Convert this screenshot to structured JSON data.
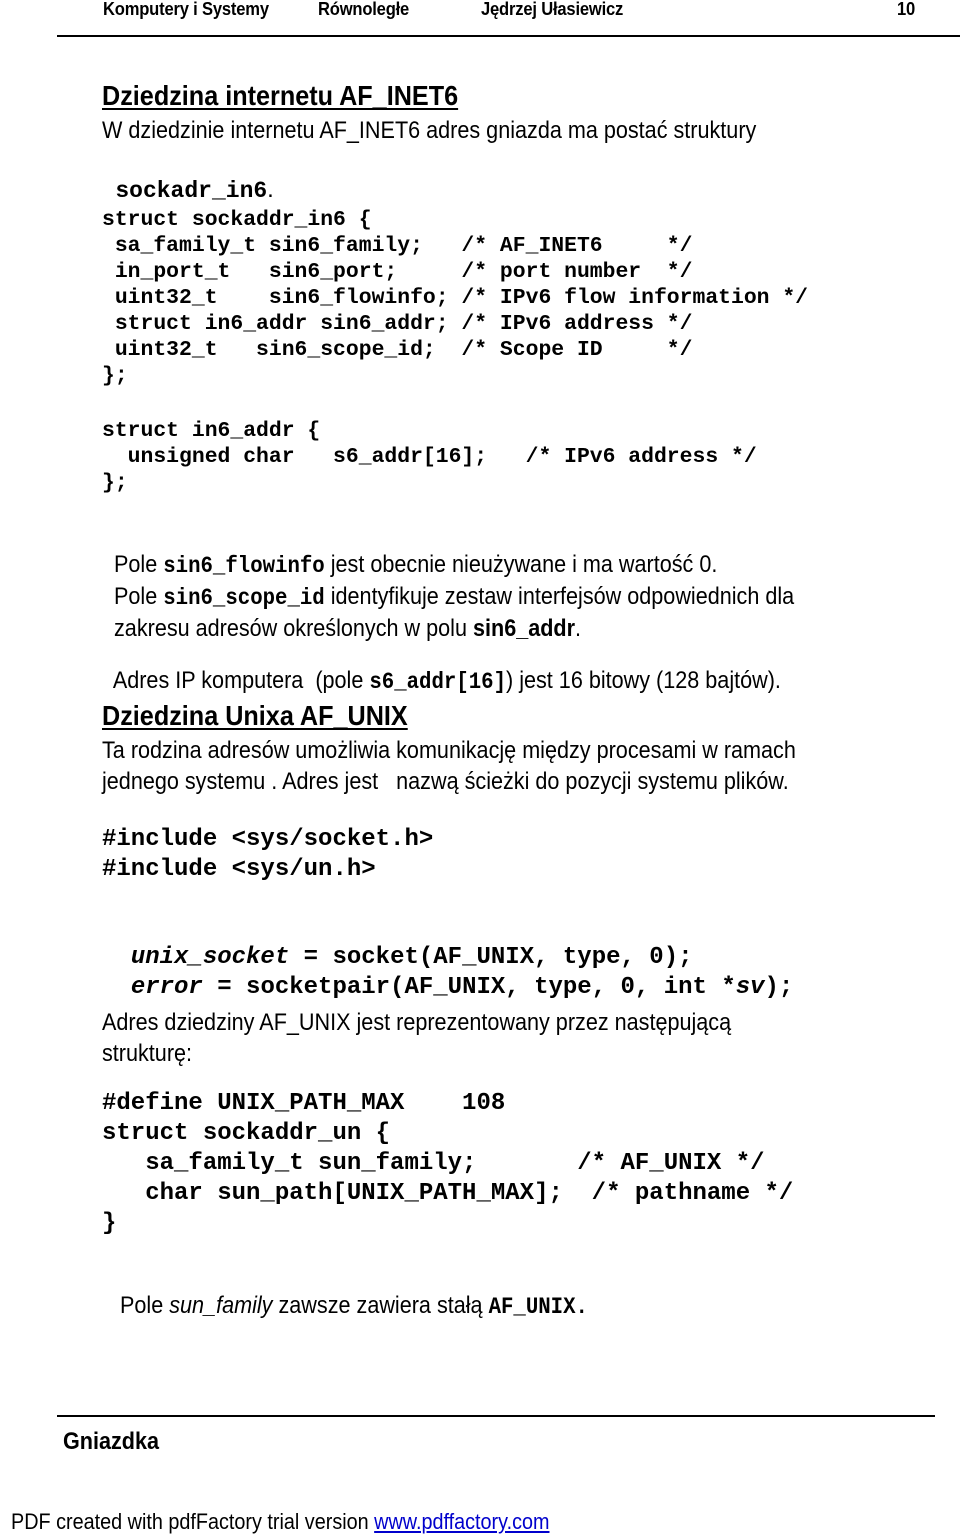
{
  "header": {
    "course": "Komputery i Systemy",
    "course2": "Równoległe",
    "author": "Jędrzej Ułasiewicz",
    "page_number": "10"
  },
  "section1": {
    "title": "Dziedzina internetu AF_INET6",
    "intro_line1": "W dziedzinie internetu AF_INET6 adres gniazda ma postać struktury",
    "intro_code": "sockadr_in6",
    "intro_end": ".",
    "code_sockaddr_in6": [
      "struct sockaddr_in6 {",
      " sa_family_t sin6_family;   /* AF_INET6     */",
      " in_port_t   sin6_port;     /* port number  */",
      " uint32_t    sin6_flowinfo; /* IPv6 flow information */",
      " struct in6_addr sin6_addr; /* IPv6 address */",
      " uint32_t   sin6_scope_id;  /* Scope ID     */",
      "};"
    ],
    "code_in6_addr": [
      "struct in6_addr {",
      "  unsigned char   s6_addr[16];   /* IPv6 address */",
      "};"
    ],
    "para_flowinfo": {
      "pre": "Pole ",
      "code": "sin6_flowinfo",
      "post": " jest obecnie nieużywane i ma wartość 0."
    },
    "para_scope": {
      "pre": "Pole ",
      "code": "sin6_scope_id",
      "post": " identyfikuje zestaw interfejsów odpowiednich dla",
      "line2_pre": "zakresu adresów określonych w polu ",
      "line2_bold": "sin6_addr",
      "line2_post": "."
    },
    "para_addr": {
      "pre": "Adres IP komputera  (pole ",
      "code": "s6_addr[16]",
      "post": ") jest 16 bitowy (128 bajtów)."
    }
  },
  "section2": {
    "title": "Dziedzina Unixa AF_UNIX",
    "intro_line1": "Ta rodzina adresów umożliwia komunikację między procesami w ramach",
    "intro_line2": "jednego systemu . Adres jest   nazwą ścieżki do pozycji systemu plików.",
    "includes": [
      "#include <sys/socket.h>",
      "#include <sys/un.h>"
    ],
    "call1": {
      "var": "unix_socket",
      "rest": " = socket(AF_UNIX, type, 0);"
    },
    "call2": {
      "var": "error",
      "mid": " = socketpair(AF_UNIX, type, 0, int *",
      "arg": "sv",
      "end": ");"
    },
    "struct_intro_line1": "Adres dziedziny AF_UNIX jest reprezentowany przez następującą",
    "struct_intro_line2": "strukturę:",
    "code_sockaddr_un": [
      "#define UNIX_PATH_MAX    108",
      "struct sockaddr_un {",
      "   sa_family_t sun_family;       /* AF_UNIX */",
      "   char sun_path[UNIX_PATH_MAX];  /* pathname */",
      "}"
    ],
    "final_note": {
      "pre": "Pole ",
      "italic": "sun_family",
      "mid": " zawsze zawiera stałą ",
      "code": "AF_UNIX."
    }
  },
  "bottom": {
    "chapter": "Gniazdka"
  },
  "footer": {
    "text": "PDF created with pdfFactory trial version ",
    "link": "www.pdffactory.com",
    "link_color": "#0000cc"
  }
}
